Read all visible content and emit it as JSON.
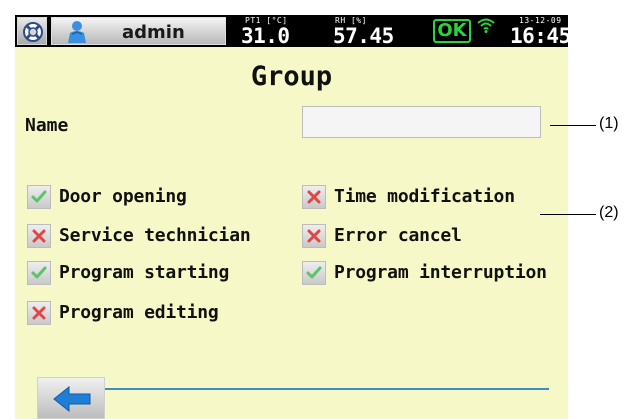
{
  "status_bar": {
    "user": "admin",
    "temperature": {
      "caption": "PT1 [°C]",
      "value": "31.0"
    },
    "humidity": {
      "caption": "RH [%]",
      "value": "57.45"
    },
    "status": "OK",
    "date": "13-12-09",
    "time": "16:45"
  },
  "page": {
    "title": "Group"
  },
  "name_field": {
    "label": "Name",
    "value": "",
    "placeholder": ""
  },
  "permissions": [
    {
      "label": "Door opening",
      "state": "allowed"
    },
    {
      "label": "Time modification",
      "state": "denied"
    },
    {
      "label": "Service technician",
      "state": "denied"
    },
    {
      "label": "Error cancel",
      "state": "denied"
    },
    {
      "label": "Program starting",
      "state": "allowed"
    },
    {
      "label": "Program interruption",
      "state": "allowed"
    },
    {
      "label": "Program editing",
      "state": "denied"
    }
  ],
  "callouts": [
    "(1)",
    "(2)"
  ],
  "colors": {
    "screen_background": "#f7f8c8",
    "status_bar": "#000000",
    "ok_green": "#27d43a",
    "check_green": "#5cc46b",
    "cross_red": "#e04646",
    "accent_blue": "#3b8ec4"
  },
  "icons": {
    "help": "lifebuoy-icon",
    "user": "user-icon",
    "connection": "wifi-icon",
    "back": "back-arrow-icon"
  }
}
